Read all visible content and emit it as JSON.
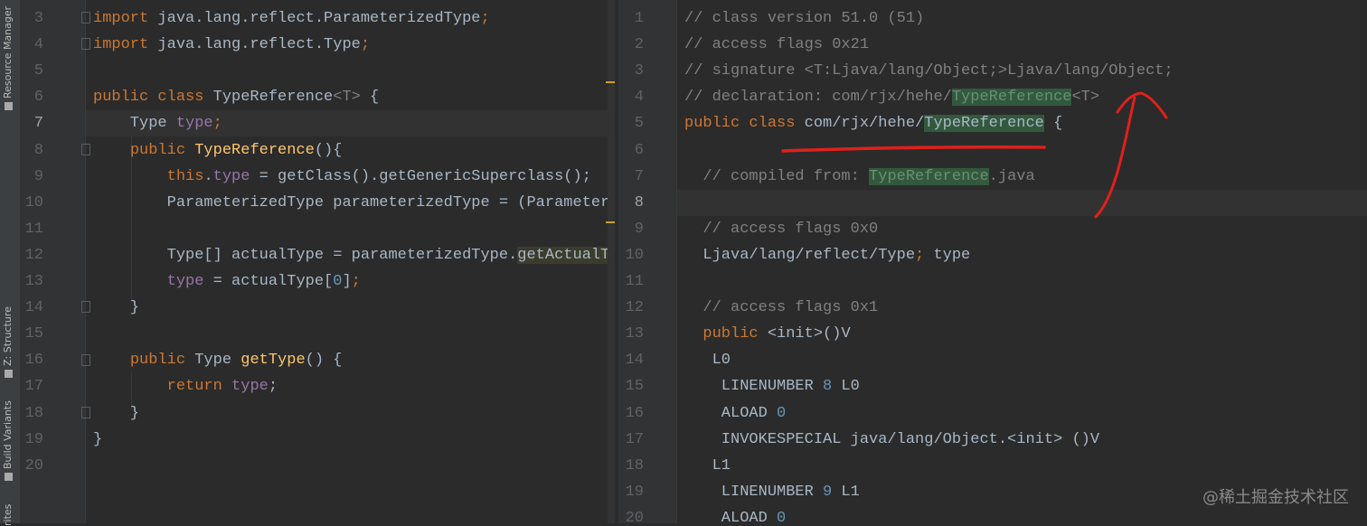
{
  "sidebar": {
    "tabs": [
      "Resource Manager",
      "Z: Structure",
      "Build Variants",
      "rites"
    ]
  },
  "left_editor": {
    "current_line": 7,
    "lines": [
      {
        "n": "3",
        "t": [
          [
            "import",
            "kw"
          ],
          [
            " java.lang.reflect.ParameterizedType",
            "p"
          ],
          [
            ";",
            "semi"
          ]
        ]
      },
      {
        "n": "4",
        "t": [
          [
            "import",
            "kw"
          ],
          [
            " java.lang.reflect.Type",
            "p"
          ],
          [
            ";",
            "semi"
          ]
        ]
      },
      {
        "n": "5",
        "t": []
      },
      {
        "n": "6",
        "t": [
          [
            "public class ",
            "kw"
          ],
          [
            "TypeReference",
            "p"
          ],
          [
            "<T>",
            "gen"
          ],
          [
            " {",
            "p"
          ]
        ]
      },
      {
        "n": "7",
        "t": [
          [
            "    Type ",
            "p"
          ],
          [
            "type",
            "field"
          ],
          [
            ";",
            "semi"
          ]
        ]
      },
      {
        "n": "8",
        "t": [
          [
            "    ",
            "p"
          ],
          [
            "public ",
            "kw"
          ],
          [
            "TypeReference",
            "fn"
          ],
          [
            "(){",
            "p"
          ]
        ]
      },
      {
        "n": "9",
        "t": [
          [
            "        ",
            "p"
          ],
          [
            "this",
            "kw"
          ],
          [
            ".",
            "p"
          ],
          [
            "type",
            "field"
          ],
          [
            " = getClass().getGenericSuperclass();",
            "p"
          ]
        ]
      },
      {
        "n": "10",
        "t": [
          [
            "        ParameterizedType parameterizedType = (Parameter",
            "p"
          ]
        ]
      },
      {
        "n": "11",
        "t": []
      },
      {
        "n": "12",
        "t": [
          [
            "        Type[] actualType = parameterizedType.",
            "p"
          ],
          [
            "getActualT",
            "hl"
          ]
        ]
      },
      {
        "n": "13",
        "t": [
          [
            "        ",
            "p"
          ],
          [
            "type",
            "field"
          ],
          [
            " = actualType[",
            "p"
          ],
          [
            "0",
            "num"
          ],
          [
            "]",
            "p"
          ],
          [
            ";",
            "semi"
          ]
        ]
      },
      {
        "n": "14",
        "t": [
          [
            "    }",
            "p"
          ]
        ]
      },
      {
        "n": "15",
        "t": []
      },
      {
        "n": "16",
        "t": [
          [
            "    ",
            "p"
          ],
          [
            "public ",
            "kw"
          ],
          [
            "Type ",
            "p"
          ],
          [
            "getType",
            "fn"
          ],
          [
            "() {",
            "p"
          ]
        ]
      },
      {
        "n": "17",
        "t": [
          [
            "        ",
            "p"
          ],
          [
            "return ",
            "kw"
          ],
          [
            "type",
            "field"
          ],
          [
            ";",
            "p"
          ]
        ]
      },
      {
        "n": "18",
        "t": [
          [
            "    }",
            "p"
          ]
        ]
      },
      {
        "n": "19",
        "t": [
          [
            "}",
            "p"
          ]
        ]
      },
      {
        "n": "20",
        "t": []
      }
    ]
  },
  "right_editor": {
    "current_line": 8,
    "lines": [
      {
        "n": "1",
        "t": [
          [
            "// class version 51.0 (51)",
            "cm"
          ]
        ]
      },
      {
        "n": "2",
        "t": [
          [
            "// access flags 0x21",
            "cm"
          ]
        ]
      },
      {
        "n": "3",
        "t": [
          [
            "// signature <T:Ljava/lang/Object;>Ljava/lang/Object;",
            "cm"
          ]
        ]
      },
      {
        "n": "4",
        "t": [
          [
            "// declaration: com/rjx/hehe/",
            "cm"
          ],
          [
            "TypeReference",
            "hlg cmg"
          ],
          [
            "<T>",
            "cm"
          ]
        ]
      },
      {
        "n": "5",
        "t": [
          [
            "public class ",
            "kw"
          ],
          [
            "com/rjx/hehe/",
            "p"
          ],
          [
            "TypeReference",
            "hlg p"
          ],
          [
            " {",
            "p"
          ]
        ]
      },
      {
        "n": "6",
        "t": []
      },
      {
        "n": "7",
        "t": [
          [
            "  // compiled from: ",
            "cm"
          ],
          [
            "TypeReference",
            "hlg cmg"
          ],
          [
            ".java",
            "cm"
          ]
        ]
      },
      {
        "n": "8",
        "t": []
      },
      {
        "n": "9",
        "t": [
          [
            "  // access flags 0x0",
            "cm"
          ]
        ]
      },
      {
        "n": "10",
        "t": [
          [
            "  Ljava/lang/reflect/Type",
            "p"
          ],
          [
            ";",
            "semi"
          ],
          [
            " type",
            "p"
          ]
        ]
      },
      {
        "n": "11",
        "t": []
      },
      {
        "n": "12",
        "t": [
          [
            "  // access flags 0x1",
            "cm"
          ]
        ]
      },
      {
        "n": "13",
        "t": [
          [
            "  ",
            "p"
          ],
          [
            "public",
            "kw"
          ],
          [
            " <init>()V",
            "p"
          ]
        ]
      },
      {
        "n": "14",
        "t": [
          [
            "   L0",
            "p"
          ]
        ]
      },
      {
        "n": "15",
        "t": [
          [
            "    LINENUMBER ",
            "p"
          ],
          [
            "8",
            "num"
          ],
          [
            " L0",
            "p"
          ]
        ]
      },
      {
        "n": "16",
        "t": [
          [
            "    ALOAD ",
            "p"
          ],
          [
            "0",
            "num"
          ]
        ]
      },
      {
        "n": "17",
        "t": [
          [
            "    INVOKESPECIAL java/lang/Object.<init> ()V",
            "p"
          ]
        ]
      },
      {
        "n": "18",
        "t": [
          [
            "   L1",
            "p"
          ]
        ]
      },
      {
        "n": "19",
        "t": [
          [
            "    LINENUMBER ",
            "p"
          ],
          [
            "9",
            "num"
          ],
          [
            " L1",
            "p"
          ]
        ]
      },
      {
        "n": "20",
        "t": [
          [
            "    ALOAD ",
            "p"
          ],
          [
            "0",
            "num"
          ]
        ]
      }
    ]
  },
  "watermark": "@稀土掘金技术社区",
  "colors": {
    "annotation": "#e0201b",
    "keyword": "#cc7832",
    "highlight_green": "#32593d"
  }
}
